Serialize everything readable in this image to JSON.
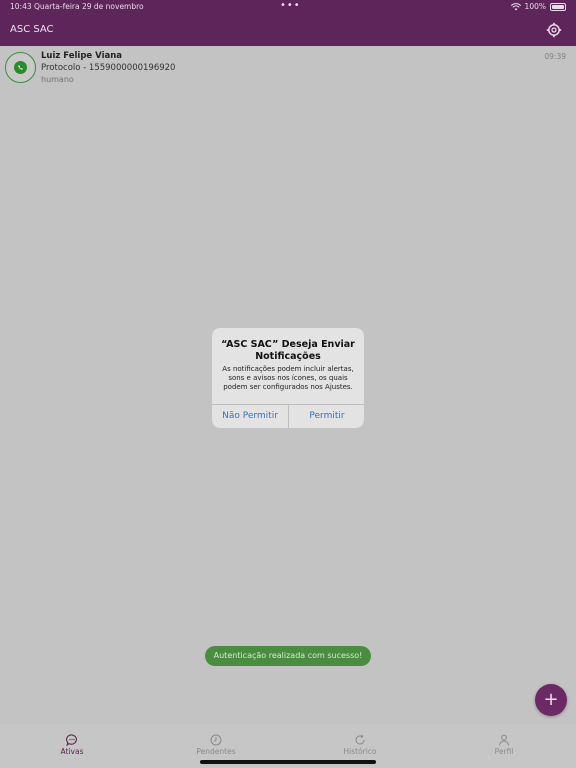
{
  "statusbar": {
    "time": "10:43",
    "date": "Quarta-feira 29 de novembro",
    "dots": "•••",
    "battery": "100%"
  },
  "appbar": {
    "title": "ASC SAC",
    "settings_icon": "gear-icon"
  },
  "conversations": [
    {
      "name": "Luiz Felipe Viana",
      "protocol": "Protocolo - 1559000000196920",
      "agent": "humano",
      "time": "09:39",
      "channel_icon": "whatsapp-icon"
    }
  ],
  "alert": {
    "title": "“ASC SAC” Deseja Enviar Notificações",
    "message": "As notificações podem incluir alertas, sons e avisos nos ícones, os quais podem ser configurados nos Ajustes.",
    "deny_label": "Não Permitir",
    "allow_label": "Permitir"
  },
  "toast": {
    "text": "Autenticação realizada com sucesso!"
  },
  "fab": {
    "label": "+"
  },
  "tabs": [
    {
      "label": "Ativas",
      "icon": "chat-icon",
      "active": true
    },
    {
      "label": "Pendentes",
      "icon": "clock-icon",
      "active": false
    },
    {
      "label": "Histórico",
      "icon": "refresh-icon",
      "active": false
    },
    {
      "label": "Perfil",
      "icon": "user-icon",
      "active": false
    }
  ],
  "colors": {
    "brand": "#5d2559",
    "success": "#4a8d40",
    "link": "#2f74c4"
  }
}
